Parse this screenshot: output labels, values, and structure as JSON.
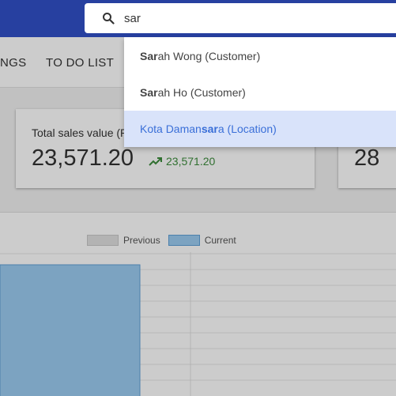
{
  "search": {
    "value": "sar",
    "placeholder": ""
  },
  "nav": {
    "tab_left": "NGS",
    "tab_todo": "TO DO LIST"
  },
  "sales_card": {
    "title": "Total sales value (R",
    "value": "23,571.20",
    "trend": "23,571.20",
    "trend_color": "#3c8c3c"
  },
  "count_card": {
    "value": "28"
  },
  "legend": {
    "previous": "Previous",
    "current": "Current"
  },
  "suggestions": [
    {
      "match": "Sar",
      "rest": "ah Wong (Customer)"
    },
    {
      "match": "Sar",
      "rest": "ah Ho (Customer)"
    },
    {
      "before": "Kota Daman",
      "match": "sar",
      "rest": "a (Location)",
      "highlighted": true
    }
  ],
  "colors": {
    "topbar": "#3150c8",
    "highlight_bg": "#d9e3fa",
    "highlight_text": "#3a6fd8",
    "bar": "#9cccf2"
  },
  "chart_data": {
    "type": "bar",
    "series": [
      {
        "name": "Previous",
        "values": []
      },
      {
        "name": "Current",
        "values": []
      }
    ],
    "grid": true
  }
}
